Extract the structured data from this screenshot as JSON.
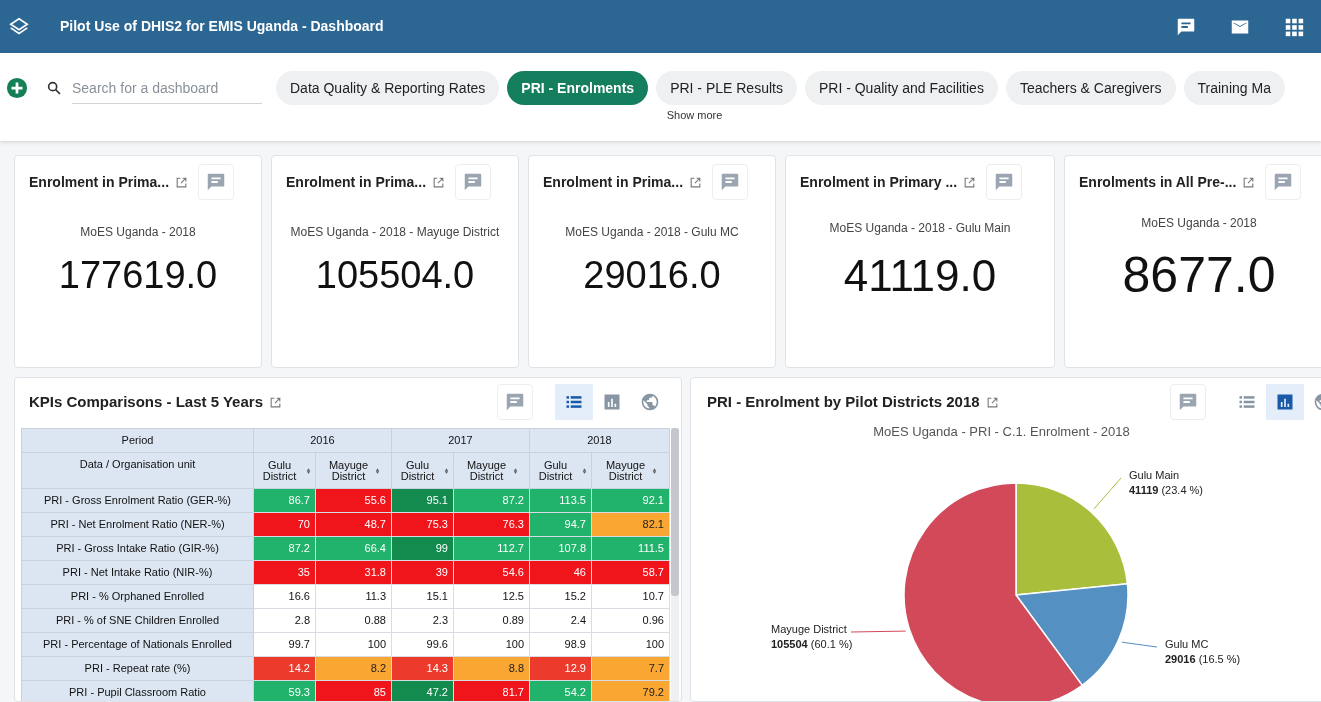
{
  "header": {
    "title": "Pilot Use of DHIS2 for EMIS Uganda - Dashboard"
  },
  "dashboard_bar": {
    "search": {
      "placeholder": "Search for a dashboard"
    },
    "tabs": [
      {
        "label": "Data Quality & Reporting Rates",
        "selected": false
      },
      {
        "label": "PRI - Enrolments",
        "selected": true
      },
      {
        "label": "PRI - PLE Results",
        "selected": false
      },
      {
        "label": "PRI - Quality and Facilities",
        "selected": false
      },
      {
        "label": "Teachers & Caregivers",
        "selected": false
      },
      {
        "label": "Training Ma",
        "selected": false
      }
    ],
    "show_more": "Show more"
  },
  "single_value_cards": [
    {
      "title": "Enrolment in Prima...",
      "subtitle": "MoES Uganda - 2018",
      "value": "177619.0"
    },
    {
      "title": "Enrolment in Prima...",
      "subtitle": "MoES Uganda - 2018 - Mayuge District",
      "value": "105504.0"
    },
    {
      "title": "Enrolment in Prima...",
      "subtitle": "MoES Uganda - 2018 - Gulu MC",
      "value": "29016.0"
    },
    {
      "title": "Enrolment in Primary ...",
      "subtitle": "MoES Uganda - 2018 - Gulu Main",
      "value": "41119.0"
    },
    {
      "title": "Enrolments in All Pre-...",
      "subtitle": "MoES Uganda - 2018",
      "value": "8677.0"
    }
  ],
  "pivot_panel": {
    "title": "KPIs Comparisons - Last 5 Years",
    "views": [
      {
        "kind": "table",
        "selected": true
      },
      {
        "kind": "chart",
        "selected": false
      },
      {
        "kind": "map",
        "selected": false
      }
    ],
    "table": {
      "period_label": "Period",
      "years": [
        "2016",
        "2017",
        "2018"
      ],
      "row_header": "Data / Organisation unit",
      "columns": [
        "Gulu District",
        "Mayuge District",
        "Gulu District",
        "Mayuge District",
        "Gulu District",
        "Mayuge District"
      ],
      "rows": [
        {
          "label": "PRI - Gross Enrolment Ratio (GER-%)",
          "cells": [
            {
              "value": "86.7",
              "color": "#21b36b"
            },
            {
              "value": "55.6",
              "color": "#f0141b"
            },
            {
              "value": "95.1",
              "color": "#138a4e"
            },
            {
              "value": "87.2",
              "color": "#21b36b"
            },
            {
              "value": "113.5",
              "color": "#21b36b"
            },
            {
              "value": "92.1",
              "color": "#21b36b"
            }
          ]
        },
        {
          "label": "PRI - Net Enrolment Ratio (NER-%)",
          "cells": [
            {
              "value": "70",
              "color": "#f0141b"
            },
            {
              "value": "48.7",
              "color": "#f0141b"
            },
            {
              "value": "75.3",
              "color": "#f0141b"
            },
            {
              "value": "76.3",
              "color": "#f0141b"
            },
            {
              "value": "94.7",
              "color": "#21b36b"
            },
            {
              "value": "82.1",
              "color": "#f9a632"
            }
          ]
        },
        {
          "label": "PRI - Gross Intake Ratio (GIR-%)",
          "cells": [
            {
              "value": "87.2",
              "color": "#21b36b"
            },
            {
              "value": "66.4",
              "color": "#21b36b"
            },
            {
              "value": "99",
              "color": "#138a4e"
            },
            {
              "value": "112.7",
              "color": "#21b36b"
            },
            {
              "value": "107.8",
              "color": "#21b36b"
            },
            {
              "value": "111.5",
              "color": "#21b36b"
            }
          ]
        },
        {
          "label": "PRI - Net Intake Ratio (NIR-%)",
          "cells": [
            {
              "value": "35",
              "color": "#f0141b"
            },
            {
              "value": "31.8",
              "color": "#f0141b"
            },
            {
              "value": "39",
              "color": "#f0141b"
            },
            {
              "value": "54.6",
              "color": "#f0141b"
            },
            {
              "value": "46",
              "color": "#f0141b"
            },
            {
              "value": "58.7",
              "color": "#f0141b"
            }
          ]
        },
        {
          "label": "PRI - % Orphaned Enrolled",
          "cells": [
            {
              "value": "16.6"
            },
            {
              "value": "11.3"
            },
            {
              "value": "15.1"
            },
            {
              "value": "12.5"
            },
            {
              "value": "15.2"
            },
            {
              "value": "10.7"
            }
          ]
        },
        {
          "label": "PRI - % of SNE Children Enrolled",
          "cells": [
            {
              "value": "2.8"
            },
            {
              "value": "0.88"
            },
            {
              "value": "2.3"
            },
            {
              "value": "0.89"
            },
            {
              "value": "2.4"
            },
            {
              "value": "0.96"
            }
          ]
        },
        {
          "label": "PRI - Percentage of Nationals Enrolled",
          "cells": [
            {
              "value": "99.7"
            },
            {
              "value": "100"
            },
            {
              "value": "99.6"
            },
            {
              "value": "100"
            },
            {
              "value": "98.9"
            },
            {
              "value": "100"
            }
          ]
        },
        {
          "label": "PRI - Repeat rate (%)",
          "cells": [
            {
              "value": "14.2",
              "color": "#ec3b2d"
            },
            {
              "value": "8.2",
              "color": "#f9a632"
            },
            {
              "value": "14.3",
              "color": "#ec3b2d"
            },
            {
              "value": "8.8",
              "color": "#f9a632"
            },
            {
              "value": "12.9",
              "color": "#ec3b2d"
            },
            {
              "value": "7.7",
              "color": "#f9a632"
            }
          ]
        },
        {
          "label": "PRI - Pupil Classroom Ratio",
          "cells": [
            {
              "value": "59.3",
              "color": "#21b36b"
            },
            {
              "value": "85",
              "color": "#f0141b"
            },
            {
              "value": "47.2",
              "color": "#138a4e"
            },
            {
              "value": "81.7",
              "color": "#f0141b"
            },
            {
              "value": "54.2",
              "color": "#21b36b"
            },
            {
              "value": "79.2",
              "color": "#f9a632"
            }
          ]
        }
      ]
    }
  },
  "pie_panel": {
    "title": "PRI - Enrolment by Pilot Districts 2018",
    "views": [
      {
        "kind": "table",
        "selected": false
      },
      {
        "kind": "chart",
        "selected": true
      },
      {
        "kind": "map",
        "selected": false
      }
    ],
    "chart_data": {
      "type": "pie",
      "title": "MoES Uganda - PRI - C.1. Enrolment - 2018",
      "categories": [
        "Gulu Main",
        "Gulu MC",
        "Mayuge District"
      ],
      "values": [
        41119,
        29016,
        105504
      ],
      "colors": [
        "#a9bf3c",
        "#5590c2",
        "#d2495a"
      ],
      "value_labels": [
        "**41119** (23.4 %)",
        "**29016** (16.5 %)",
        "**105504** (60.1 %)"
      ]
    }
  }
}
